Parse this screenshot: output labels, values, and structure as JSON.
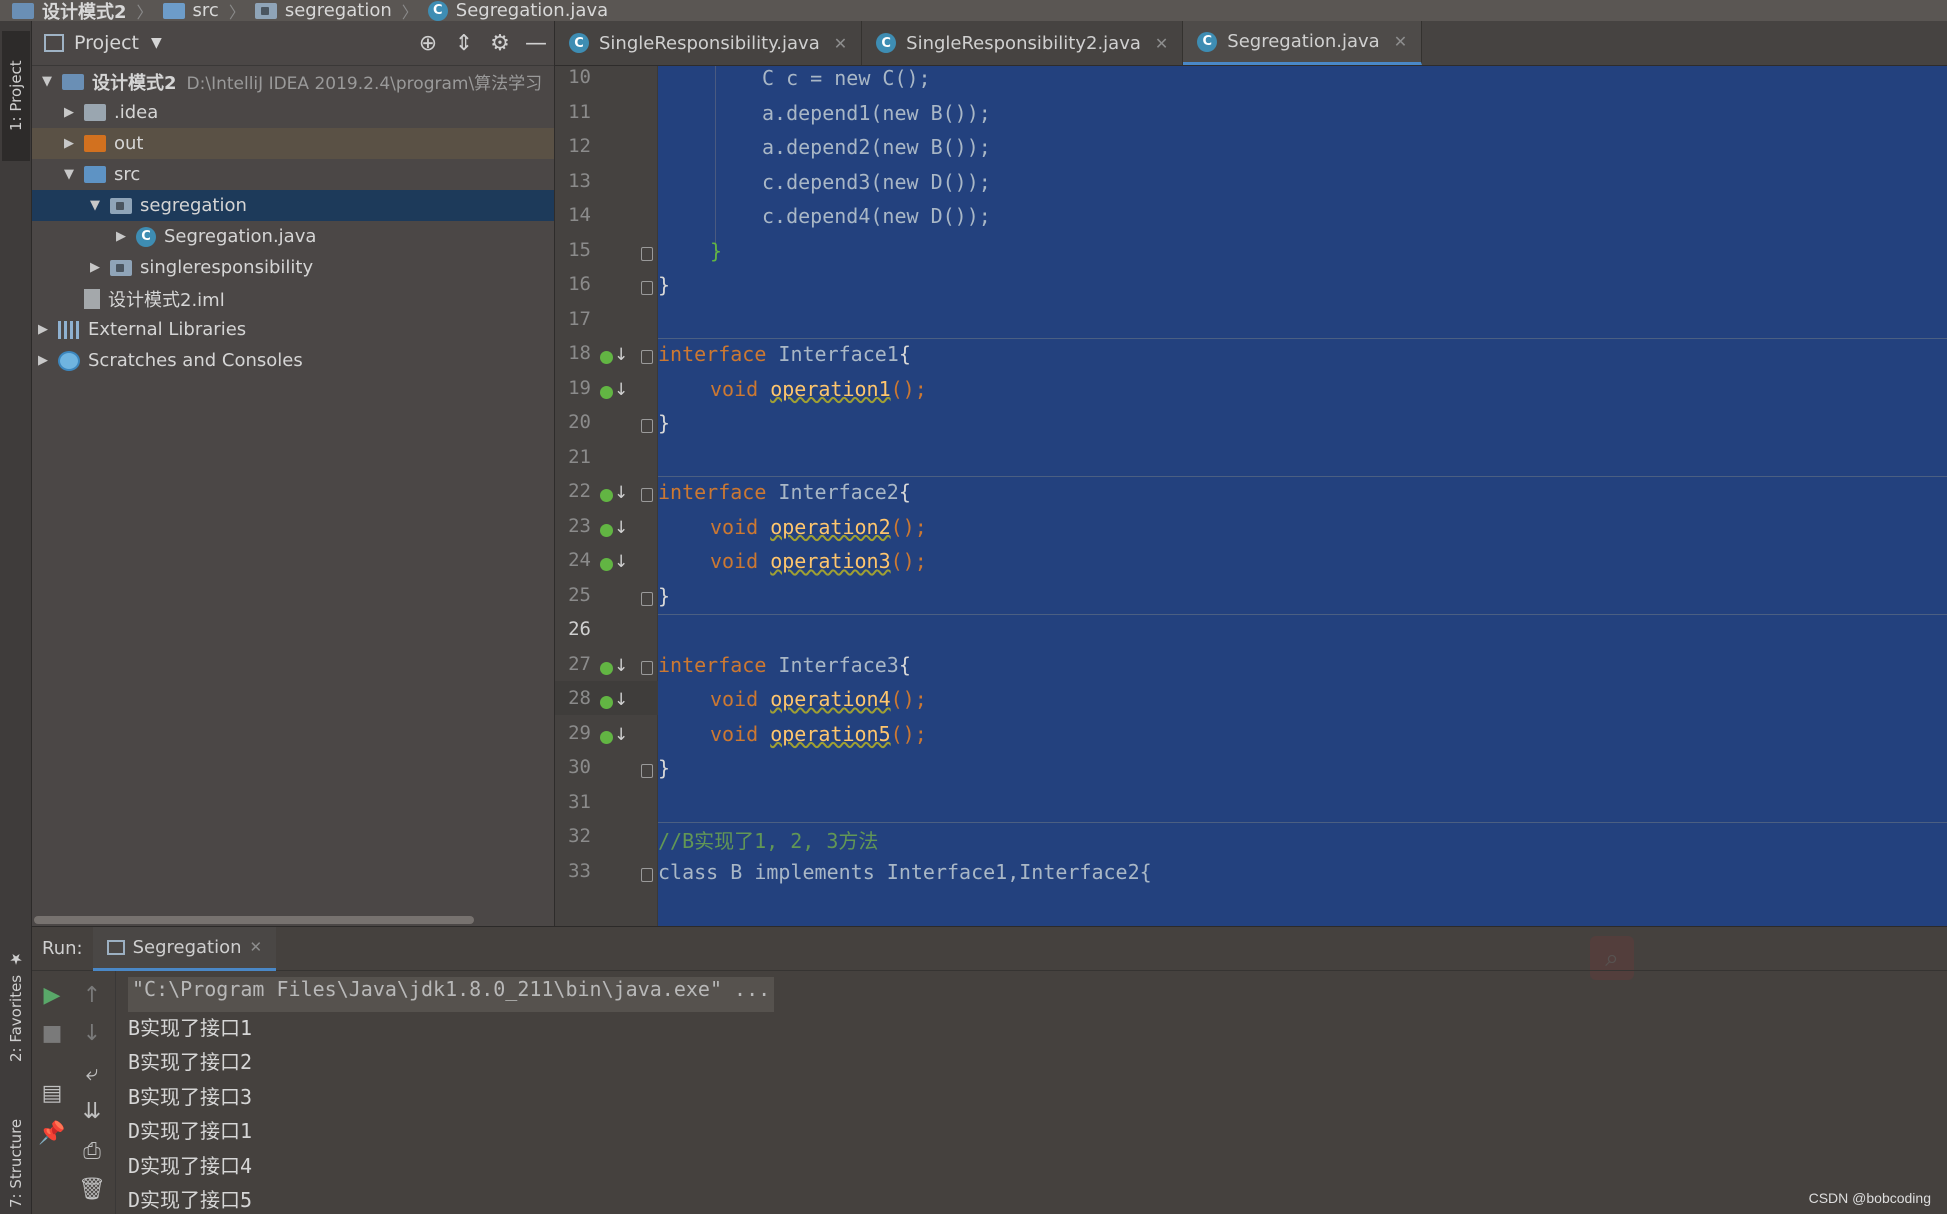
{
  "breadcrumb": [
    "设计模式2",
    "src",
    "segregation",
    "Segregation.java"
  ],
  "left_stripe": {
    "project": "1: Project",
    "favorites": "2: Favorites",
    "structure": "7: Structure"
  },
  "project_panel": {
    "title": "Project",
    "tree": [
      {
        "label": "设计模式2",
        "hint": "D:\\IntelliJ IDEA 2019.2.4\\program\\算法学习"
      },
      {
        "label": ".idea"
      },
      {
        "label": "out"
      },
      {
        "label": "src"
      },
      {
        "label": "segregation"
      },
      {
        "label": "Segregation.java"
      },
      {
        "label": "singleresponsibility"
      },
      {
        "label": "设计模式2.iml"
      },
      {
        "label": "External Libraries"
      },
      {
        "label": "Scratches and Consoles"
      }
    ]
  },
  "editor_tabs": [
    {
      "label": "SingleResponsibility.java"
    },
    {
      "label": "SingleResponsibility2.java"
    },
    {
      "label": "Segregation.java"
    }
  ],
  "editor": {
    "line_numbers": [
      "10",
      "11",
      "12",
      "13",
      "14",
      "15",
      "16",
      "17",
      "18",
      "19",
      "20",
      "21",
      "22",
      "23",
      "24",
      "25",
      "26",
      "27",
      "28",
      "29",
      "30",
      "31",
      "32",
      "33"
    ],
    "current_line": "26",
    "code": {
      "l10": "C c = new C();",
      "l11": "a.depend1(new B());",
      "l12": "a.depend2(new B());",
      "l13": "c.depend3(new D());",
      "l14": "c.depend4(new D());",
      "iface1": "Interface1",
      "iface2": "Interface2",
      "iface3": "Interface3",
      "op1": "operation1",
      "op2": "operation2",
      "op3": "operation3",
      "op4": "operation4",
      "op5": "operation5",
      "comment32": "//B实现了1, 2, 3方法",
      "l33": "class B implements Interface1,Interface2{"
    }
  },
  "run_panel": {
    "label": "Run:",
    "tab": "Segregation",
    "console": [
      "\"C:\\Program Files\\Java\\jdk1.8.0_211\\bin\\java.exe\" ...",
      "B实现了接口1",
      "B实现了接口2",
      "B实现了接口3",
      "D实现了接口1",
      "D实现了接口4",
      "D实现了接口5"
    ]
  },
  "watermark": "CSDN @bobcoding",
  "colors": {
    "selection": "#214283",
    "keyword": "#cc7832",
    "method": "#ffc66d",
    "comment": "#629755",
    "accent": "#4a88c7"
  }
}
